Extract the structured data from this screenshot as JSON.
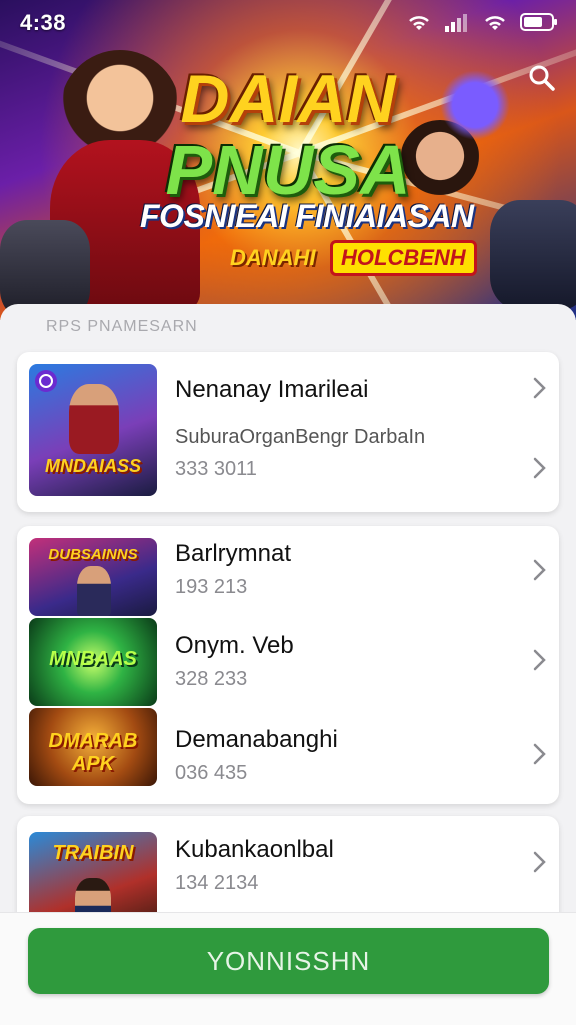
{
  "status_bar": {
    "time": "4:38",
    "icons": [
      "wifi-icon",
      "signal-icon",
      "wifi-icon",
      "battery-icon"
    ]
  },
  "hero": {
    "title_line1": "DAIAN",
    "title_line2": "PNUSA",
    "subtitle": "FOSNIEAI FINIAIASAN",
    "badge_left": "DANAHI",
    "badge_right": "HOLCBENH",
    "search_icon": "search-icon"
  },
  "list": {
    "section_label": "RPS   PNAMESARN",
    "cards": [
      {
        "items": [
          {
            "thumb_text": "MNDAIASS",
            "thumb_icon": "play-icon",
            "title": "Nenanay Imarileai",
            "subtitle": "SuburaOrganBengr DarbaIn",
            "number": "333 3011"
          }
        ]
      },
      {
        "items": [
          {
            "thumb_text": "DUBSAINNS",
            "title": "Barlrymnat",
            "number": "193 213"
          },
          {
            "thumb_text": "MNBAAS",
            "title": "Onym. Veb",
            "number": "328 233"
          },
          {
            "thumb_text": "DMARAB APK",
            "title": "Demanabanghi",
            "number": "036 435"
          }
        ]
      },
      {
        "items": [
          {
            "thumb_text": "TRAIBIN",
            "title": "Kubankaonlbal",
            "number": "134 2134"
          }
        ]
      }
    ]
  },
  "cta": {
    "label": "YONNISSHN"
  },
  "colors": {
    "accent": "#2f9a3d",
    "title_yellow": "#ffd21f",
    "title_green": "#7ee34a"
  }
}
